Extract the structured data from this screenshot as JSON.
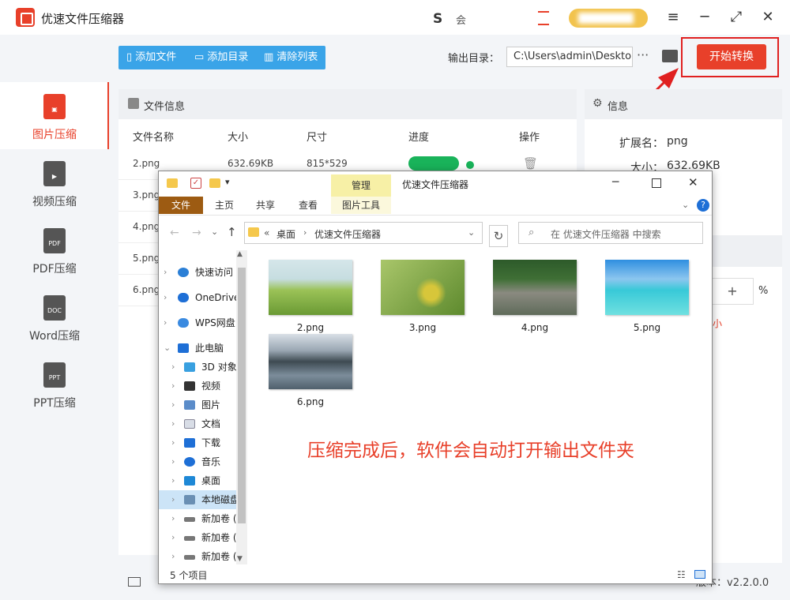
{
  "app": {
    "title": "优速文件压缩器",
    "status_text": "会",
    "version_label": "版本：v2.2.0.0"
  },
  "sidebar": {
    "items": [
      {
        "label": "图片压缩",
        "icon": "image-file-icon",
        "badge": ""
      },
      {
        "label": "视频压缩",
        "icon": "video-file-icon",
        "badge": ""
      },
      {
        "label": "PDF压缩",
        "icon": "pdf-file-icon",
        "badge": "PDF"
      },
      {
        "label": "Word压缩",
        "icon": "doc-file-icon",
        "badge": "DOC"
      },
      {
        "label": "PPT压缩",
        "icon": "ppt-file-icon",
        "badge": "PPT"
      }
    ]
  },
  "toolbar": {
    "add_file": "添加文件",
    "add_dir": "添加目录",
    "clear_list": "清除列表",
    "output_label": "输出目录：",
    "output_path": "C:\\Users\\admin\\Desktop",
    "start": "开始转换"
  },
  "file_panel": {
    "title": "文件信息",
    "columns": [
      "文件名称",
      "大小",
      "尺寸",
      "进度",
      "操作"
    ],
    "rows": [
      {
        "name": "2.png",
        "size": "632.69KB",
        "dim": "815*529"
      },
      {
        "name": "3.png"
      },
      {
        "name": "4.png"
      },
      {
        "name": "5.png"
      },
      {
        "name": "6.png"
      }
    ]
  },
  "info_panel": {
    "title": "信息",
    "ext_label": "扩展名：",
    "ext_value": "png",
    "size_label": "大小：",
    "size_value": "632.69KB",
    "plus": "+",
    "percent": "%",
    "hint_fragment": "越小"
  },
  "explorer": {
    "title": "优速文件压缩器",
    "manage_tab": "管理",
    "ribbon_tabs": [
      "文件",
      "主页",
      "共享",
      "查看",
      "图片工具"
    ],
    "breadcrumb": [
      "桌面",
      "优速文件压缩器"
    ],
    "search_placeholder": "在 优速文件压缩器 中搜索",
    "tree": [
      "快速访问",
      "OneDrive",
      "WPS网盘",
      "此电脑",
      "3D 对象",
      "视频",
      "图片",
      "文档",
      "下载",
      "音乐",
      "桌面",
      "本地磁盘",
      "新加卷 (",
      "新加卷 (",
      "新加卷 ("
    ],
    "files": [
      "2.png",
      "3.png",
      "4.png",
      "5.png",
      "6.png"
    ],
    "item_count": "5 个项目"
  },
  "annotation": "压缩完成后，软件会自动打开输出文件夹",
  "colors": {
    "accent": "#e8402a",
    "toolbar_blue": "#3aa4e8",
    "progress_green": "#19b35a",
    "annotation_red": "#e02020"
  }
}
